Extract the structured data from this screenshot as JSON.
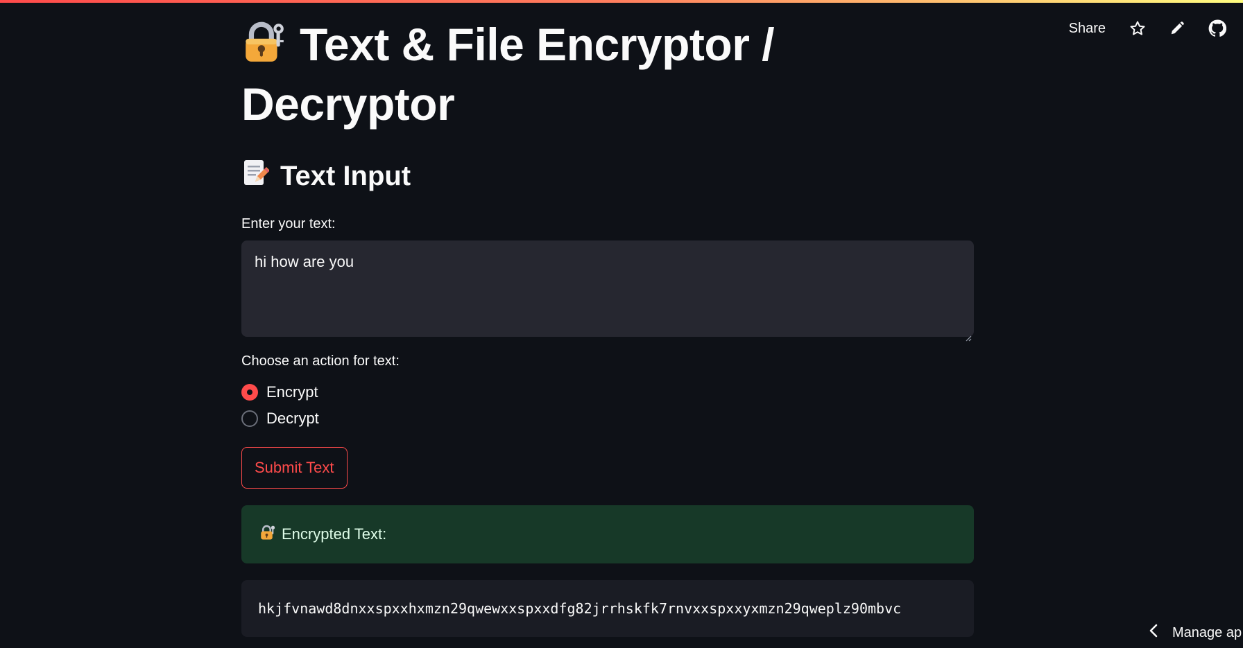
{
  "header": {
    "share_label": "Share",
    "icons": [
      "star-icon",
      "pencil-icon",
      "github-icon"
    ]
  },
  "title": {
    "icon": "lock-with-key-icon",
    "text": "Text & File Encryptor / Decryptor"
  },
  "text_section": {
    "icon": "memo-icon",
    "heading": "Text Input",
    "input_label": "Enter your text:",
    "input_value": "hi how are you",
    "action_label": "Choose an action for text:",
    "options": [
      {
        "label": "Encrypt",
        "selected": true
      },
      {
        "label": "Decrypt",
        "selected": false
      }
    ],
    "submit_label": "Submit Text"
  },
  "result": {
    "icon": "lock-with-key-icon",
    "success_label": "Encrypted Text:",
    "output": "hkjfvnawd8dnxxspxxhxmzn29qwewxxspxxdfg82jrrhskfk7rnvxxspxxyxmzn29qweplz90mbvc"
  },
  "footer": {
    "manage_label": "Manage ap"
  },
  "colors": {
    "background": "#0e1117",
    "accent": "#ff4b4b",
    "input_bg": "#262730",
    "success_bg": "#173928",
    "code_bg": "#1a1c24"
  }
}
